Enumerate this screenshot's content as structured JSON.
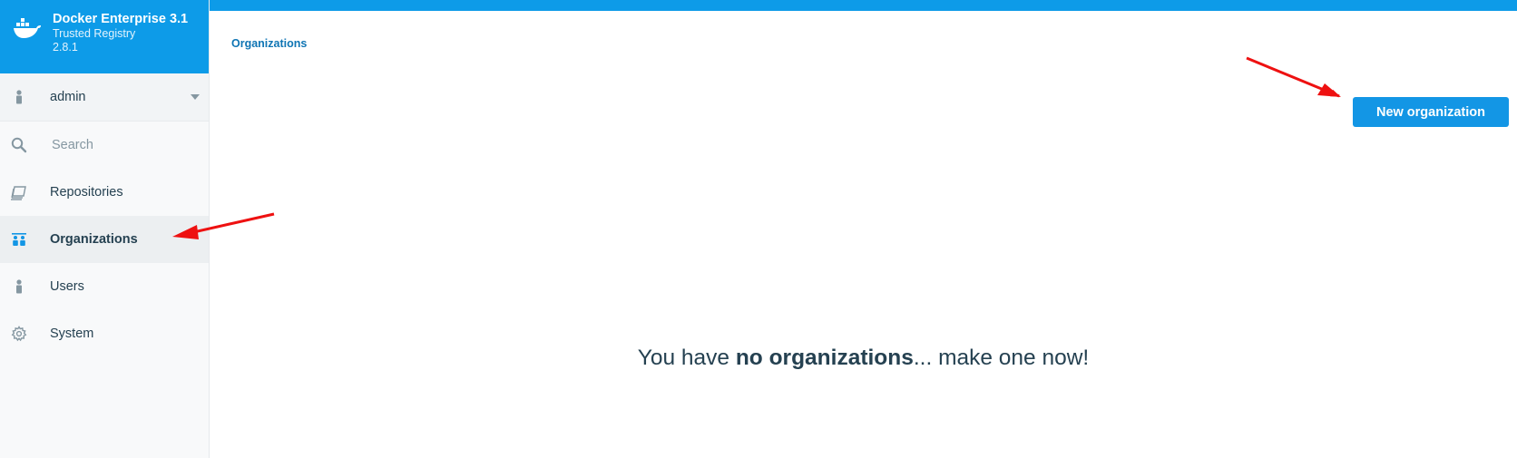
{
  "brand": {
    "title": "Docker Enterprise 3.1",
    "subtitle": "Trusted Registry",
    "version": "2.8.1"
  },
  "user": {
    "name": "admin"
  },
  "search": {
    "placeholder": "Search"
  },
  "nav": {
    "repositories": "Repositories",
    "organizations": "Organizations",
    "users": "Users",
    "system": "System"
  },
  "main": {
    "breadcrumb": "Organizations",
    "new_button": "New organization",
    "empty_prefix": "You have ",
    "empty_bold": "no organizations",
    "empty_suffix": "... make one now!"
  },
  "colors": {
    "brand_blue": "#0d9be8",
    "button_blue": "#1396e5",
    "annotation_red": "#ee1111"
  }
}
